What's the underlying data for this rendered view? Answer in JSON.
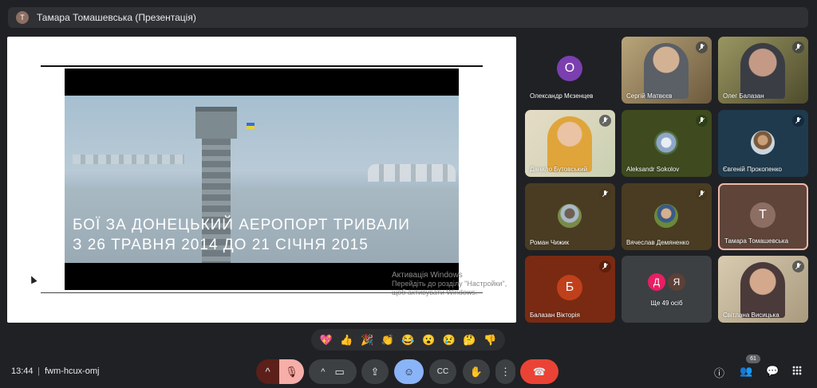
{
  "presenter_bar": {
    "avatar_letter": "Т",
    "title": "Тамара Томашевська (Презентація)"
  },
  "presentation": {
    "caption_line1": "БОЇ ЗА ДОНЕЦЬКИЙ АЕРОПОРТ ТРИВАЛИ",
    "caption_line2": "З 26  ТРАВНЯ 2014 ДО 21 СІЧНЯ 2015",
    "watermark_title": "Активація Windows",
    "watermark_sub": "Перейдіть до розділу \"Настройки\", щоб активувати Windows."
  },
  "participants": [
    {
      "name": "Олександр Мєзенцев",
      "avatar_letter": "О",
      "bg": "#5b2a86",
      "avatar_bg": "#7b3fb0"
    },
    {
      "name": "Сергій Матвєєв",
      "bg": "#8a7a5c"
    },
    {
      "name": "Олег Балазан",
      "bg": "#7c7a52"
    },
    {
      "name": "Данило Бутовський",
      "bg": "#d9cfb8"
    },
    {
      "name": "Aleksandr Sokolov",
      "bg": "#3f4a1f"
    },
    {
      "name": "Євгеній Прокопенко",
      "bg": "#1f3a4d"
    },
    {
      "name": "Роман Чижик",
      "bg": "#4a3c22"
    },
    {
      "name": "Вячеслав Демяненко",
      "bg": "#4a3c22"
    },
    {
      "name": "Тамара Томашевська",
      "avatar_letter": "Т",
      "bg": "#5e4439",
      "avatar_bg": "#8d6e63"
    },
    {
      "name": "Балазан Вікторія",
      "avatar_letter": "Б",
      "bg": "#7a2a12",
      "avatar_bg": "#c0401b"
    },
    {
      "name": "Ще 49 осіб",
      "letters": [
        "Д",
        "Я"
      ],
      "bg": "#3c4043"
    },
    {
      "name": "Світлана Висицька",
      "bg": "#c9b89a"
    }
  ],
  "reactions": [
    "💖",
    "👍",
    "🎉",
    "👏",
    "😂",
    "😮",
    "😢",
    "🤔",
    "👎"
  ],
  "bottom_bar": {
    "time": "13:44",
    "separator": "|",
    "meeting_code": "fwm-hcux-omj",
    "participants_count": "61"
  },
  "icons": {
    "caret": "^",
    "mic_off": "🎙",
    "camera": "▭",
    "present": "⇪",
    "emoji": "☺",
    "captions": "CC",
    "raise_hand": "✋",
    "more": "⋮",
    "end_call": "☎",
    "info": "ⓘ",
    "people": "👥",
    "chat": "💬"
  }
}
